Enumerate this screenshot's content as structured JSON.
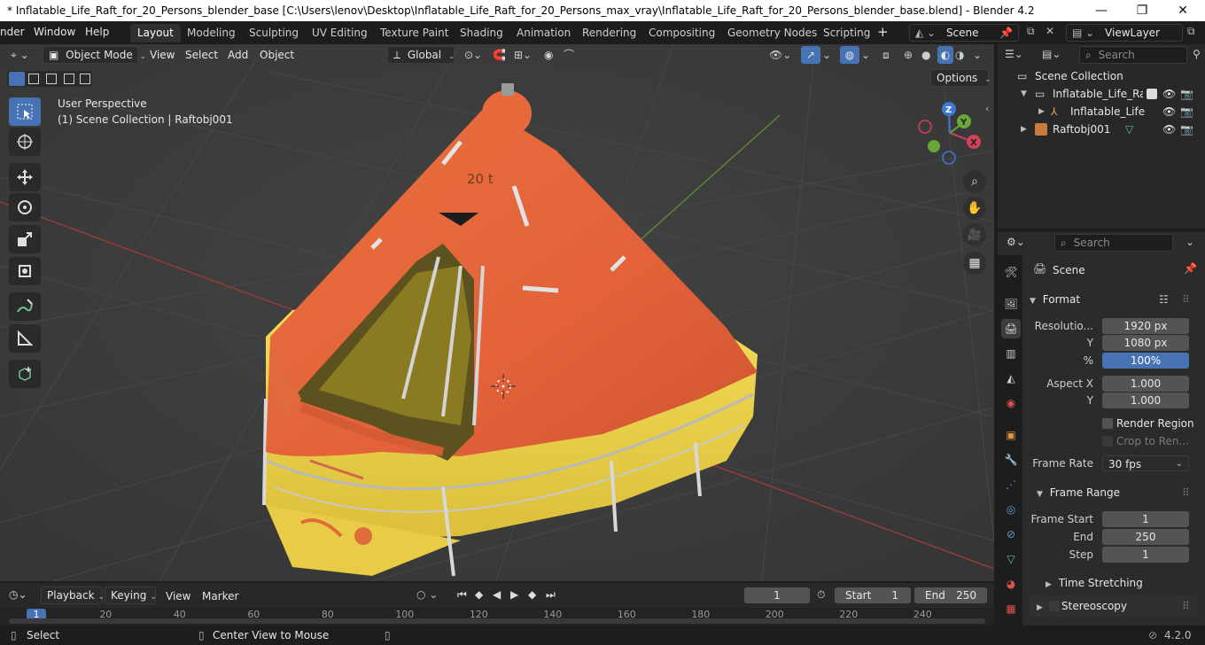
{
  "window": {
    "title": "* Inflatable_Life_Raft_for_20_Persons_blender_base [C:\\Users\\lenov\\Desktop\\Inflatable_Life_Raft_for_20_Persons_max_vray\\Inflatable_Life_Raft_for_20_Persons_blender_base.blend] - Blender 4.2",
    "minimize": "—",
    "maximize": "❐",
    "close": "✕"
  },
  "menu": {
    "render": "nder",
    "window": "Window",
    "help": "Help"
  },
  "workspaces": [
    "Layout",
    "Modeling",
    "Sculpting",
    "UV Editing",
    "Texture Paint",
    "Shading",
    "Animation",
    "Rendering",
    "Compositing",
    "Geometry Nodes",
    "Scripting"
  ],
  "active_workspace": "Layout",
  "scene_field": "Scene",
  "viewlayer_field": "ViewLayer",
  "viewport": {
    "mode": "Object Mode",
    "menus": [
      "View",
      "Select",
      "Add",
      "Object"
    ],
    "orientation": "Global",
    "options": "Options",
    "overlay_line1": "User Perspective",
    "overlay_line2": "(1) Scene Collection | Raftobj001",
    "model_label": "20 t",
    "gizmo": {
      "x": "X",
      "y": "Y",
      "z": "Z"
    }
  },
  "outliner": {
    "search_placeholder": "Search",
    "rows": [
      {
        "label": "Scene Collection"
      },
      {
        "label": "Inflatable_Life_Raft"
      },
      {
        "label": "Inflatable_Life_"
      },
      {
        "label": "Raftobj001"
      }
    ]
  },
  "properties": {
    "search_placeholder": "Search",
    "context": "Scene",
    "format_panel": "Format",
    "resolution_label": "Resolutio...",
    "res_x": "1920 px",
    "y_label": "Y",
    "res_y": "1080 px",
    "percent_label": "%",
    "res_percent": "100%",
    "percent_value": 1.0,
    "aspect_x_label": "Aspect X",
    "aspect_x": "1.000",
    "aspect_y": "1.000",
    "render_region": "Render Region",
    "crop": "Crop to Ren...",
    "frame_rate_label": "Frame Rate",
    "frame_rate": "30 fps",
    "frame_range_panel": "Frame Range",
    "frame_start_label": "Frame Start",
    "frame_start": "1",
    "end_label": "End",
    "frame_end": "250",
    "step_label": "Step",
    "step": "1",
    "time_stretching": "Time Stretching",
    "stereoscopy": "Stereoscopy"
  },
  "timeline": {
    "menus": [
      "Playback",
      "Keying",
      "View",
      "Marker"
    ],
    "current_frame": "1",
    "start_label": "Start",
    "start": "1",
    "end_label": "End",
    "end": "250",
    "ruler": [
      "1",
      "20",
      "40",
      "60",
      "80",
      "100",
      "120",
      "140",
      "160",
      "180",
      "200",
      "220",
      "240"
    ]
  },
  "status": {
    "select": "Select",
    "center_view": "Center View to Mouse",
    "version": "4.2.0"
  },
  "colors": {
    "accent": "#4772b3",
    "raft_orange": "#e4643a",
    "raft_yellow": "#f0d84c",
    "viewport_bg": "#3d3d3d"
  }
}
